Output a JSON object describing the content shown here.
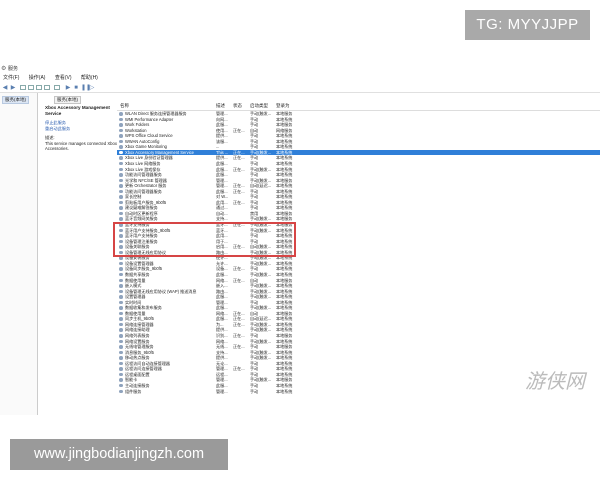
{
  "watermarks": {
    "top": "TG: MYYJJPP",
    "bottom": "www.jingbodianjingzh.com",
    "logo_right": "游侠网"
  },
  "window": {
    "title": "服务",
    "menu": [
      "文件(F)",
      "操作(A)",
      "查看(V)",
      "帮助(H)"
    ],
    "left_node": "服务(本地)",
    "tab": "服务(本地)"
  },
  "description": {
    "title": "Xbox Accessory Management Service",
    "links": [
      "停止此服务",
      "重启动此服务"
    ],
    "desc_label": "描述:",
    "desc_text": "This service manages connected Xbox Accessories."
  },
  "columns": [
    "名称",
    "描述",
    "状态",
    "启动类型",
    "登录为"
  ],
  "rows": [
    {
      "name": "WLAN Direct 服务连接管理器服务",
      "desc": "管理...",
      "status": "",
      "startup": "手动(触发...",
      "logon": "本地服务"
    },
    {
      "name": "WMI Performance Adapter",
      "desc": "向网...",
      "status": "",
      "startup": "手动",
      "logon": "本地系统"
    },
    {
      "name": "Work Folders",
      "desc": "此服...",
      "status": "",
      "startup": "手动",
      "logon": "本地服务"
    },
    {
      "name": "Workstation",
      "desc": "使用...",
      "status": "正在...",
      "startup": "自动",
      "logon": "网络服务"
    },
    {
      "name": "WPS Office Cloud Service",
      "desc": "提供...",
      "status": "",
      "startup": "手动",
      "logon": "本地系统"
    },
    {
      "name": "WWAN AutoConfig",
      "desc": "该服...",
      "status": "",
      "startup": "手动",
      "logon": "本地系统"
    },
    {
      "name": "Xbox Game Monitoring",
      "desc": "...",
      "status": "",
      "startup": "手动",
      "logon": "本地系统"
    },
    {
      "name": "Xbox Accessory Management Service",
      "desc": "This ...",
      "status": "正在...",
      "startup": "手动(触发...",
      "logon": "本地系统"
    },
    {
      "name": "Xbox Live 身份验证管理器",
      "desc": "提供...",
      "status": "正在...",
      "startup": "手动",
      "logon": "本地系统"
    },
    {
      "name": "Xbox Live 网络服务",
      "desc": "此服...",
      "status": "",
      "startup": "手动",
      "logon": "本地系统"
    },
    {
      "name": "Xbox Live 游戏保存",
      "desc": "此服...",
      "status": "正在...",
      "startup": "手动(触发...",
      "logon": "本地系统"
    },
    {
      "name": "功能访问管理器服务",
      "desc": "此服...",
      "status": "",
      "startup": "手动",
      "logon": "本地系统"
    },
    {
      "name": "光学和 NFC/SE 管理器",
      "desc": "管理...",
      "status": "",
      "startup": "手动(触发...",
      "logon": "本地服务"
    },
    {
      "name": "更新 Orchestrator 服务",
      "desc": "管理...",
      "status": "正在...",
      "startup": "自动(延迟...",
      "logon": "本地系统"
    },
    {
      "name": "功能访问管理器服务",
      "desc": "此服...",
      "status": "正在...",
      "startup": "手动",
      "logon": "本地系统"
    },
    {
      "name": "家长控制",
      "desc": "对 W...",
      "status": "",
      "startup": "手动",
      "logon": "本地系统"
    },
    {
      "name": "剪贴板用户服务_9b0f5",
      "desc": "此用...",
      "status": "正在...",
      "startup": "手动",
      "logon": "本地系统"
    },
    {
      "name": "建议疑难解答服务",
      "desc": "通过...",
      "status": "",
      "startup": "手动",
      "logon": "本地系统"
    },
    {
      "name": "自动时区更新程序",
      "desc": "自动...",
      "status": "",
      "startup": "禁用",
      "logon": "本地服务"
    },
    {
      "name": "蓝牙音频网关服务",
      "desc": "支持...",
      "status": "",
      "startup": "手动(触发...",
      "logon": "本地服务"
    },
    {
      "name": "蓝牙支持服务",
      "desc": "蓝牙...",
      "status": "正在...",
      "startup": "手动(触发...",
      "logon": "本地服务"
    },
    {
      "name": "蓝牙用户支持服务_9b0f5",
      "desc": "蓝牙...",
      "status": "",
      "startup": "手动(触发...",
      "logon": "本地系统"
    },
    {
      "name": "蓝牙用户支持服务",
      "desc": "此用...",
      "status": "",
      "startup": "手动",
      "logon": "本地系统"
    },
    {
      "name": "设备管理注册服务",
      "desc": "用于...",
      "status": "",
      "startup": "手动",
      "logon": "本地系统"
    },
    {
      "name": "设备关联服务",
      "desc": "启用...",
      "status": "正在...",
      "startup": "自动(触发...",
      "logon": "本地系统"
    },
    {
      "name": "设备管理无线应用协议",
      "desc": "路由...",
      "status": "",
      "startup": "手动(触发...",
      "logon": "本地系统"
    },
    {
      "name": "设备安装服务",
      "desc": "使计...",
      "status": "",
      "startup": "手动(触发...",
      "logon": "本地系统"
    },
    {
      "name": "设备设置管理器",
      "desc": "允许...",
      "status": "",
      "startup": "手动(触发...",
      "logon": "本地系统"
    },
    {
      "name": "设备同步服务_9b0f5",
      "desc": "设备...",
      "status": "正在...",
      "startup": "手动",
      "logon": "本地系统"
    },
    {
      "name": "数据共享服务",
      "desc": "此服...",
      "status": "",
      "startup": "手动(触发...",
      "logon": "本地系统"
    },
    {
      "name": "数据使用量",
      "desc": "网络...",
      "status": "正在...",
      "startup": "自动",
      "logon": "本地服务"
    },
    {
      "name": "嵌入模式",
      "desc": "嵌入...",
      "status": "",
      "startup": "手动(触发...",
      "logon": "本地系统"
    },
    {
      "name": "设备管理无线应用协议 (WAP) 推送消息",
      "desc": "路由...",
      "status": "",
      "startup": "手动(触发...",
      "logon": "本地系统"
    },
    {
      "name": "设置管理器",
      "desc": "此服...",
      "status": "",
      "startup": "手动(触发...",
      "logon": "本地系统"
    },
    {
      "name": "实时时间",
      "desc": "管理...",
      "status": "",
      "startup": "手动",
      "logon": "本地系统"
    },
    {
      "name": "数据收集和发布服务",
      "desc": "此服...",
      "status": "",
      "startup": "手动(触发...",
      "logon": "本地系统"
    },
    {
      "name": "数据使用量",
      "desc": "网络...",
      "status": "正在...",
      "startup": "自动",
      "logon": "本地服务"
    },
    {
      "name": "同步主机_9b0f5",
      "desc": "此服...",
      "status": "正在...",
      "startup": "自动(延迟...",
      "logon": "本地系统"
    },
    {
      "name": "网络连接管理器",
      "desc": "为...",
      "status": "正在...",
      "startup": "手动(触发...",
      "logon": "本地系统"
    },
    {
      "name": "网络连接助理",
      "desc": "提供...",
      "status": "",
      "startup": "手动(触发...",
      "logon": "本地系统"
    },
    {
      "name": "网络列表服务",
      "desc": "识别...",
      "status": "正在...",
      "startup": "手动",
      "logon": "本地服务"
    },
    {
      "name": "网络设置服务",
      "desc": "网络...",
      "status": "",
      "startup": "手动(触发...",
      "logon": "本地系统"
    },
    {
      "name": "无线电管理服务",
      "desc": "无线...",
      "status": "正在...",
      "startup": "手动",
      "logon": "本地服务"
    },
    {
      "name": "消息服务_9b0f5",
      "desc": "支持...",
      "status": "",
      "startup": "手动(触发...",
      "logon": "本地系统"
    },
    {
      "name": "移动热点服务",
      "desc": "提供...",
      "status": "",
      "startup": "手动(触发...",
      "logon": "本地系统"
    },
    {
      "name": "远程访问自动连接管理器",
      "desc": "无论...",
      "status": "",
      "startup": "手动",
      "logon": "本地系统"
    },
    {
      "name": "远程访问连接管理器",
      "desc": "管理...",
      "status": "正在...",
      "startup": "手动",
      "logon": "本地系统"
    },
    {
      "name": "远程桌面配置",
      "desc": "远程...",
      "status": "",
      "startup": "手动",
      "logon": "本地系统"
    },
    {
      "name": "智能卡",
      "desc": "管理...",
      "status": "",
      "startup": "手动(触发...",
      "logon": "本地服务"
    },
    {
      "name": "主动连接服务",
      "desc": "此服...",
      "status": "",
      "startup": "手动",
      "logon": "本地系统"
    },
    {
      "name": "组件服务",
      "desc": "管理...",
      "status": "",
      "startup": "手动",
      "logon": "本地系统"
    }
  ],
  "selected_index": 7
}
